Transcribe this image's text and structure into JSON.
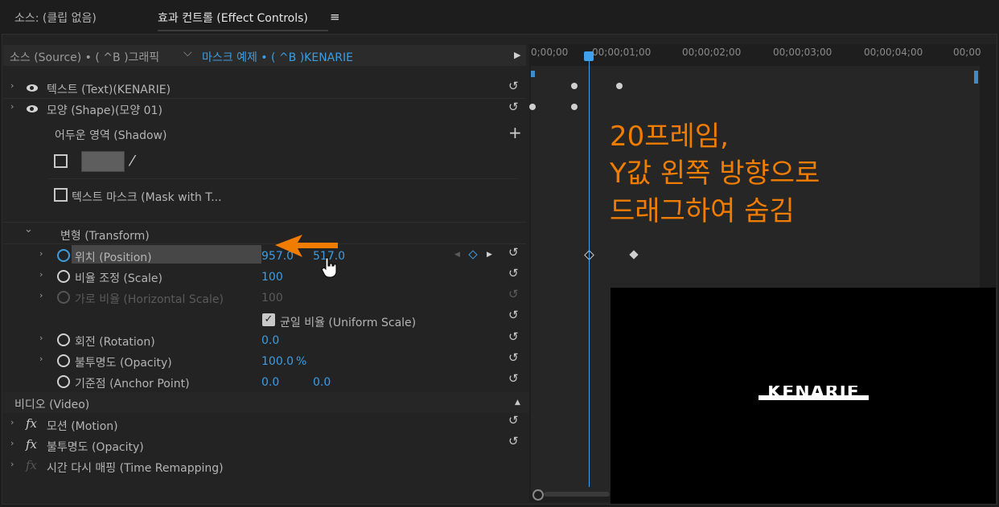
{
  "tabs": {
    "source": "소스: (클립 없음)",
    "effect_controls": "효과 컨트롤 (Effect Controls)",
    "menu_icon": "≡"
  },
  "header": {
    "source_label": "소스 (Source) • ( ^B )그래픽",
    "dropdown_chevron": "⌵",
    "sequence_label": "마스크 예제 • ( ^B )KENARIE",
    "play_icon": "▶"
  },
  "ruler": [
    "0;00;00",
    "00;00;01;00",
    "00;00;02;00",
    "00;00;03;00",
    "00;00;04;00",
    "00;00"
  ],
  "rows": {
    "text": "텍스트 (Text)(KENARIE)",
    "shape": "모양 (Shape)(모양 01)",
    "shadow": "어두운 영역 (Shadow)",
    "mask": "텍스트 마스크 (Mask with T...",
    "transform": "변형 (Transform)",
    "position": {
      "label": "위치 (Position)",
      "x": "957.0",
      "y": "517.0"
    },
    "scale": {
      "label": "비율 조정 (Scale)",
      "value": "100"
    },
    "hscale": {
      "label": "가로 비율 (Horizontal Scale)",
      "value": "100"
    },
    "uniform": "균일 비율 (Uniform Scale)",
    "rotation": {
      "label": "회전 (Rotation)",
      "value": "0.0"
    },
    "opacity": {
      "label": "불투명도 (Opacity)",
      "value": "100.0",
      "unit": "%"
    },
    "anchor": {
      "label": "기준점 (Anchor Point)",
      "x": "0.0",
      "y": "0.0"
    },
    "video": "비디오 (Video)",
    "motion": "모션 (Motion)",
    "v_opacity": "불투명도 (Opacity)",
    "remap": "시간 다시 매핑 (Time Remapping)"
  },
  "icons": {
    "reset": "↺",
    "add": "+",
    "eyedropper": "⁄",
    "fx": "fx",
    "chevron_right": "›",
    "chevron_down": "⌄",
    "collapse": "▲",
    "prev_key": "◀",
    "next_key": "▶"
  },
  "annotation": {
    "line1": "20프레임,",
    "line2": "Y값 왼쪽 방향으로",
    "line3": "드래그하여 숨김"
  },
  "preview": {
    "text": "KENARIE"
  },
  "colors": {
    "accent": "#3d9de0",
    "annotation": "#f07d00"
  }
}
